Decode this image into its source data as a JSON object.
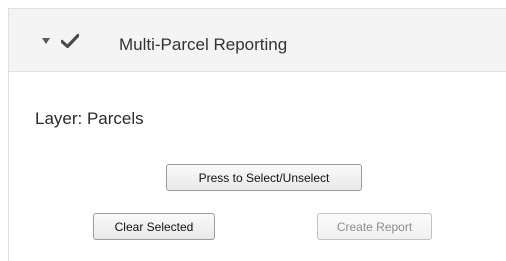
{
  "panel": {
    "title": "Multi-Parcel Reporting",
    "collapse_icon": "caret-down-icon",
    "status_icon": "checkmark-icon"
  },
  "layer": {
    "label": "Layer: Parcels"
  },
  "buttons": {
    "select_label": "Press to Select/Unselect",
    "clear_label": "Clear Selected",
    "report_label": "Create Report",
    "report_disabled": true
  },
  "colors": {
    "header_bg": "#f4f4f4",
    "text": "#333333",
    "disabled_text": "#8d8d8d"
  }
}
